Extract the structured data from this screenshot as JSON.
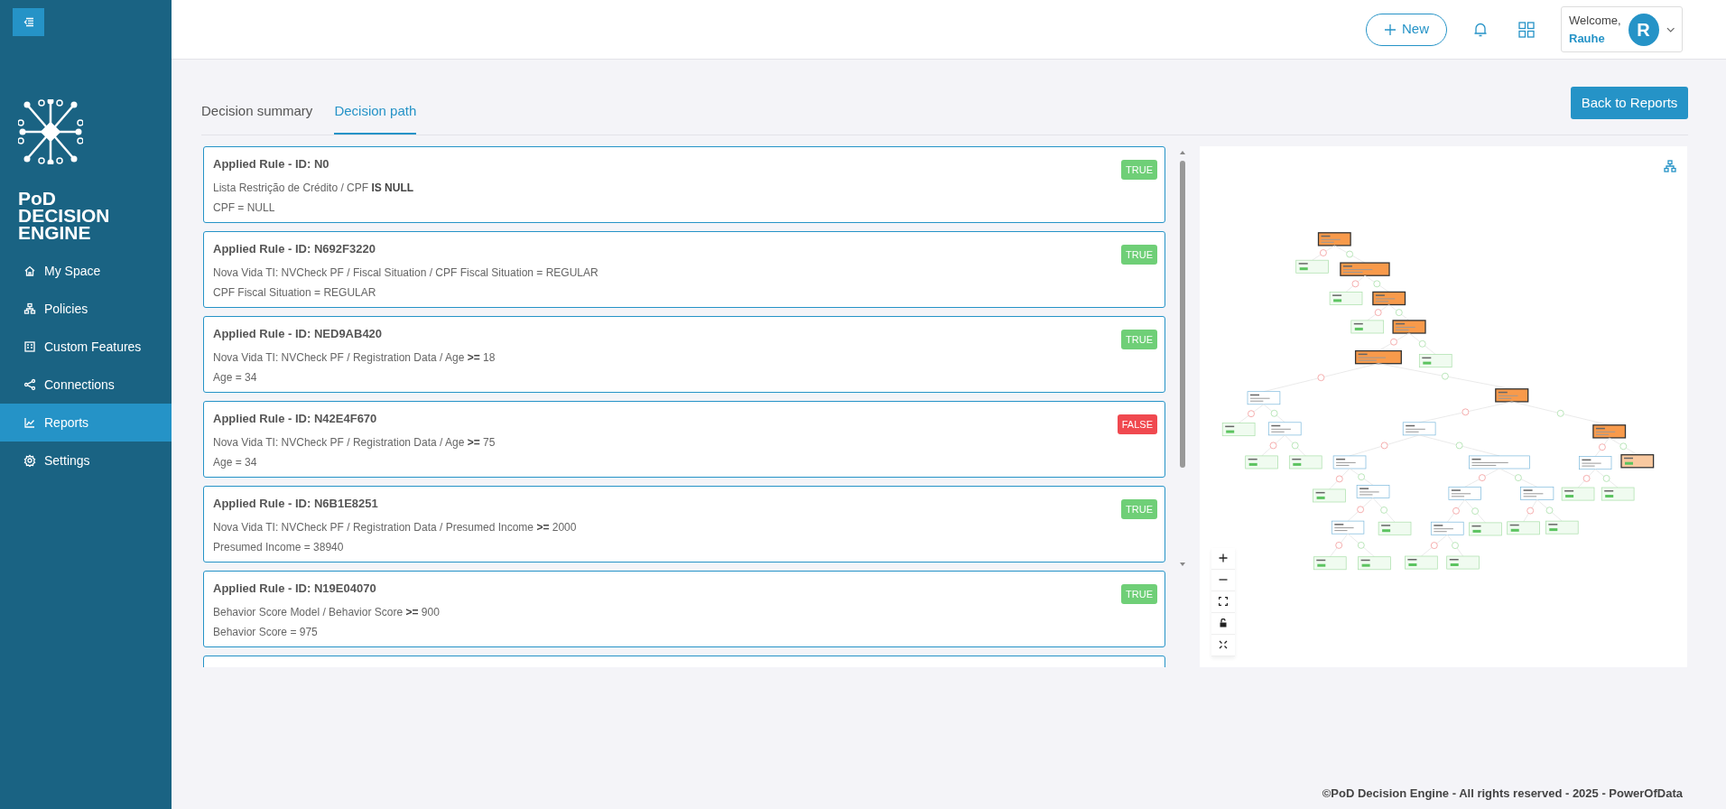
{
  "sidebar": {
    "brand": [
      "PoD",
      "DECISION",
      "ENGINE"
    ],
    "items": [
      {
        "label": "My Space",
        "selected": false
      },
      {
        "label": "Policies",
        "selected": false
      },
      {
        "label": "Custom Features",
        "selected": false
      },
      {
        "label": "Connections",
        "selected": false
      },
      {
        "label": "Reports",
        "selected": true
      },
      {
        "label": "Settings",
        "selected": false
      }
    ]
  },
  "header": {
    "new_button": "New",
    "welcome": "Welcome,",
    "user_name": "Rauhe",
    "avatar_initial": "R"
  },
  "tabs": [
    {
      "label": "Decision summary",
      "selected": false
    },
    {
      "label": "Decision path",
      "selected": true
    }
  ],
  "back_button": "Back to Reports",
  "rules": [
    {
      "title": "Applied Rule - ID: N0",
      "condition": "Lista Restrição de Crédito / CPF **IS NULL**",
      "value": "CPF = NULL",
      "result": "TRUE",
      "passed": true
    },
    {
      "title": "Applied Rule - ID: N692F3220",
      "condition": "Nova Vida TI: NVCheck PF / Fiscal Situation / CPF Fiscal Situation = REGULAR",
      "value": "CPF Fiscal Situation = REGULAR",
      "result": "TRUE",
      "passed": true
    },
    {
      "title": "Applied Rule - ID: NED9AB420",
      "condition": "Nova Vida TI: NVCheck PF / Registration Data / Age **>=** 18",
      "value": "Age = 34",
      "result": "TRUE",
      "passed": true
    },
    {
      "title": "Applied Rule - ID: N42E4F670",
      "condition": "Nova Vida TI: NVCheck PF / Registration Data / Age **>=** 75",
      "value": "Age = 34",
      "result": "FALSE",
      "passed": false
    },
    {
      "title": "Applied Rule - ID: N6B1E8251",
      "condition": "Nova Vida TI: NVCheck PF / Registration Data / Presumed Income **>=** 2000",
      "value": "Presumed Income = 38940",
      "result": "TRUE",
      "passed": true
    },
    {
      "title": "Applied Rule - ID: N19E04070",
      "condition": "Behavior Score Model / Behavior Score **>=** 900",
      "value": "Behavior Score = 975",
      "result": "TRUE",
      "passed": true
    }
  ],
  "footer": "©PoD Decision Engine - All rights reserved - 2025 - PowerOfData"
}
